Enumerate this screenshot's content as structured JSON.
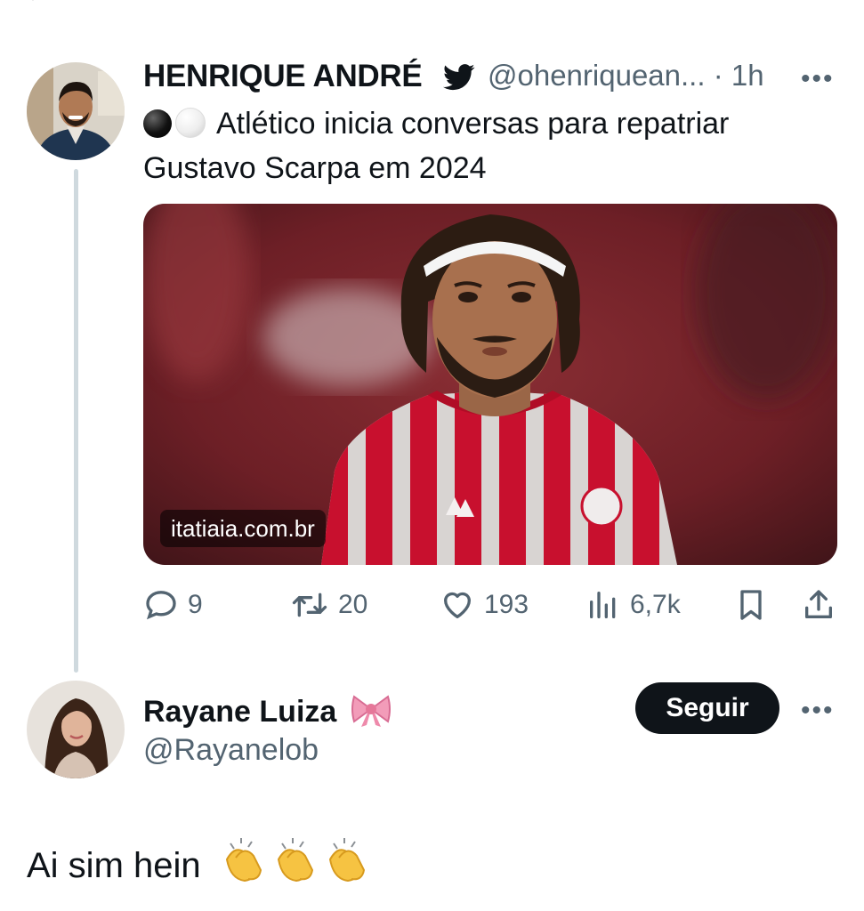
{
  "tweet": {
    "author_name": "HENRIQUE ANDRÉ",
    "author_handle": "@ohenriquean...",
    "time": "· 1h",
    "more_label": "•••",
    "text": "Atlético inicia conversas para repatriar Gustavo Scarpa em 2024",
    "media_source": "itatiaia.com.br",
    "stats": {
      "replies": "9",
      "retweets": "20",
      "likes": "193",
      "views": "6,7k"
    }
  },
  "reply": {
    "author_name": "Rayane Luiza",
    "author_handle": "@Rayanelob",
    "follow_label": "Seguir",
    "more_label": "•••",
    "text": "Ai sim hein"
  },
  "colors": {
    "text": "#0f1419",
    "secondary": "#536471",
    "thread_line": "#cfd9de",
    "verified_bird": "#0f1419",
    "jersey_red": "#c8102e"
  },
  "icons": [
    "chevron-down-icon",
    "twitter-bird-icon",
    "reply-icon",
    "retweet-icon",
    "like-icon",
    "views-icon",
    "bookmark-icon",
    "share-icon",
    "ribbon-emoji",
    "clapping-hands-emoji"
  ]
}
